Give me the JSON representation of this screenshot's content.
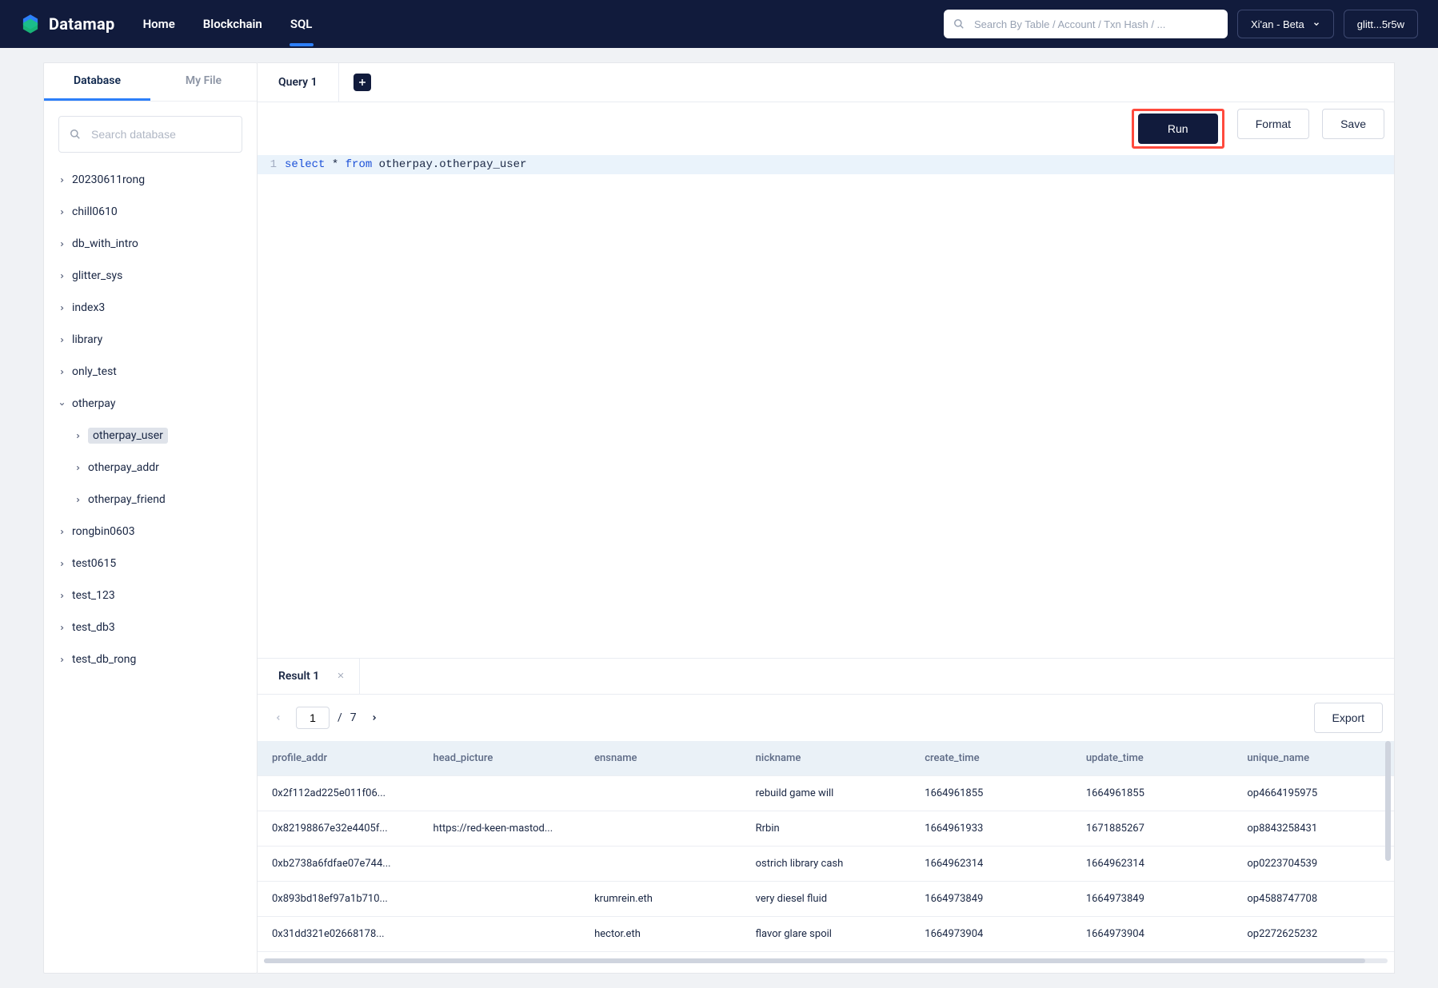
{
  "brand": {
    "name": "Datamap"
  },
  "nav": {
    "home": "Home",
    "blockchain": "Blockchain",
    "sql": "SQL",
    "active": "sql"
  },
  "topSearch": {
    "placeholder": "Search By Table / Account / Txn Hash / ..."
  },
  "region": {
    "label": "Xi'an - Beta"
  },
  "account": {
    "label": "glitt...5r5w"
  },
  "sidebar": {
    "tabs": {
      "database": "Database",
      "myfile": "My File",
      "active": "database"
    },
    "searchPlaceholder": "Search database",
    "dbs": [
      {
        "name": "20230611rong",
        "open": false
      },
      {
        "name": "chill0610",
        "open": false
      },
      {
        "name": "db_with_intro",
        "open": false
      },
      {
        "name": "glitter_sys",
        "open": false
      },
      {
        "name": "index3",
        "open": false
      },
      {
        "name": "library",
        "open": false
      },
      {
        "name": "only_test",
        "open": false
      },
      {
        "name": "otherpay",
        "open": true,
        "tables": [
          {
            "name": "otherpay_user",
            "selected": true
          },
          {
            "name": "otherpay_addr",
            "selected": false
          },
          {
            "name": "otherpay_friend",
            "selected": false
          }
        ]
      },
      {
        "name": "rongbin0603",
        "open": false
      },
      {
        "name": "test0615",
        "open": false
      },
      {
        "name": "test_123",
        "open": false
      },
      {
        "name": "test_db3",
        "open": false
      },
      {
        "name": "test_db_rong",
        "open": false
      }
    ]
  },
  "queryTabs": {
    "active": "Query 1"
  },
  "actions": {
    "run": "Run",
    "format": "Format",
    "save": "Save"
  },
  "sql": {
    "line1": {
      "select": "select",
      "star": " * ",
      "from": "from",
      "gap": "  ",
      "ident": "otherpay.otherpay_user"
    }
  },
  "resultTabs": {
    "active": "Result 1"
  },
  "pagination": {
    "page": "1",
    "sep": "/",
    "total": "7"
  },
  "exportLabel": "Export",
  "columns": [
    "profile_addr",
    "head_picture",
    "ensname",
    "nickname",
    "create_time",
    "update_time",
    "unique_name"
  ],
  "rows": [
    {
      "profile_addr": "0x2f112ad225e011f06...",
      "head_picture": "",
      "ensname": "",
      "nickname": "rebuild game will",
      "create_time": "1664961855",
      "update_time": "1664961855",
      "unique_name": "op4664195975"
    },
    {
      "profile_addr": "0x82198867e32e4405f...",
      "head_picture": "https://red-keen-mastod...",
      "ensname": "",
      "nickname": "Rrbin",
      "create_time": "1664961933",
      "update_time": "1671885267",
      "unique_name": "op8843258431"
    },
    {
      "profile_addr": "0xb2738a6fdfae07e744...",
      "head_picture": "",
      "ensname": "",
      "nickname": "ostrich library cash",
      "create_time": "1664962314",
      "update_time": "1664962314",
      "unique_name": "op0223704539"
    },
    {
      "profile_addr": "0x893bd18ef97a1b710...",
      "head_picture": "",
      "ensname": "krumrein.eth",
      "nickname": "very diesel fluid",
      "create_time": "1664973849",
      "update_time": "1664973849",
      "unique_name": "op4588747708"
    },
    {
      "profile_addr": "0x31dd321e02668178...",
      "head_picture": "",
      "ensname": "hector.eth",
      "nickname": "flavor glare spoil",
      "create_time": "1664973904",
      "update_time": "1664973904",
      "unique_name": "op2272625232"
    }
  ]
}
